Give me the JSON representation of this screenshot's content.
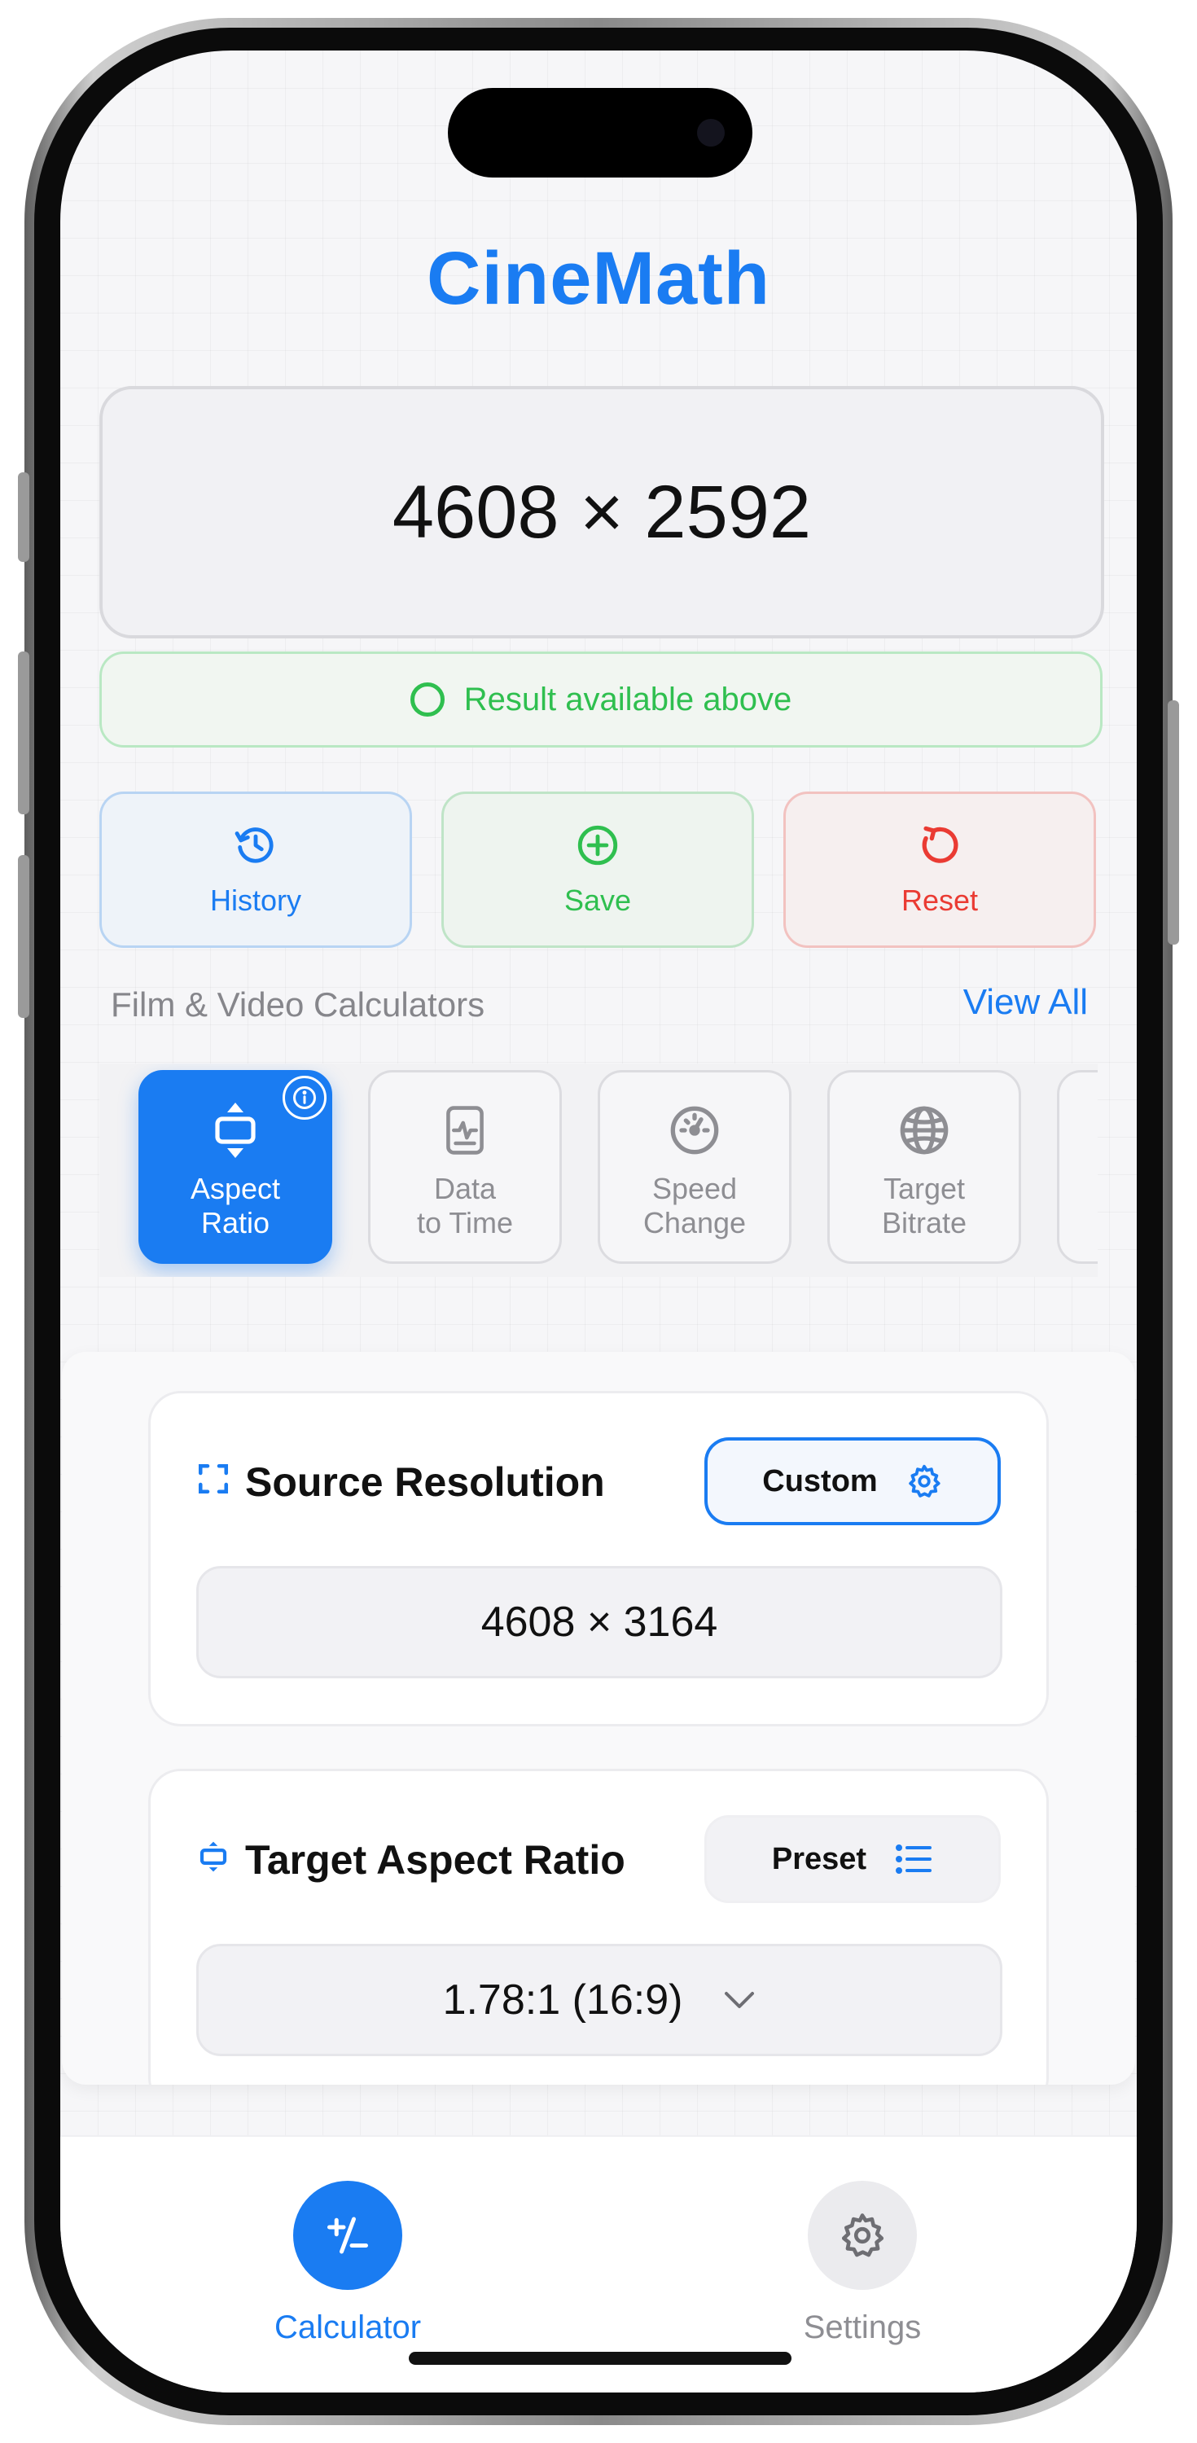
{
  "app": {
    "title": "CineMath"
  },
  "display": {
    "value": "4608 × 2592"
  },
  "status": {
    "text": "Result available above"
  },
  "actions": {
    "history": "History",
    "save": "Save",
    "reset": "Reset"
  },
  "section": {
    "label": "Film & Video Calculators",
    "view_all": "View All"
  },
  "calculators": [
    {
      "label_line1": "Aspect",
      "label_line2": "Ratio",
      "icon": "aspect-ratio-icon",
      "active": true
    },
    {
      "label_line1": "Data",
      "label_line2": "to Time",
      "icon": "document-icon",
      "active": false
    },
    {
      "label_line1": "Speed",
      "label_line2": "Change",
      "icon": "gauge-icon",
      "active": false
    },
    {
      "label_line1": "Target",
      "label_line2": "Bitrate",
      "icon": "globe-icon",
      "active": false
    }
  ],
  "source": {
    "title": "Source Resolution",
    "mode": "Custom",
    "value": "4608 × 3164"
  },
  "target": {
    "title": "Target Aspect Ratio",
    "mode": "Preset",
    "value": "1.78:1 (16:9)"
  },
  "tabs": {
    "calculator": "Calculator",
    "settings": "Settings"
  },
  "colors": {
    "accent": "#1a7cf2",
    "success": "#2fbf4f",
    "danger": "#ea3b33"
  }
}
